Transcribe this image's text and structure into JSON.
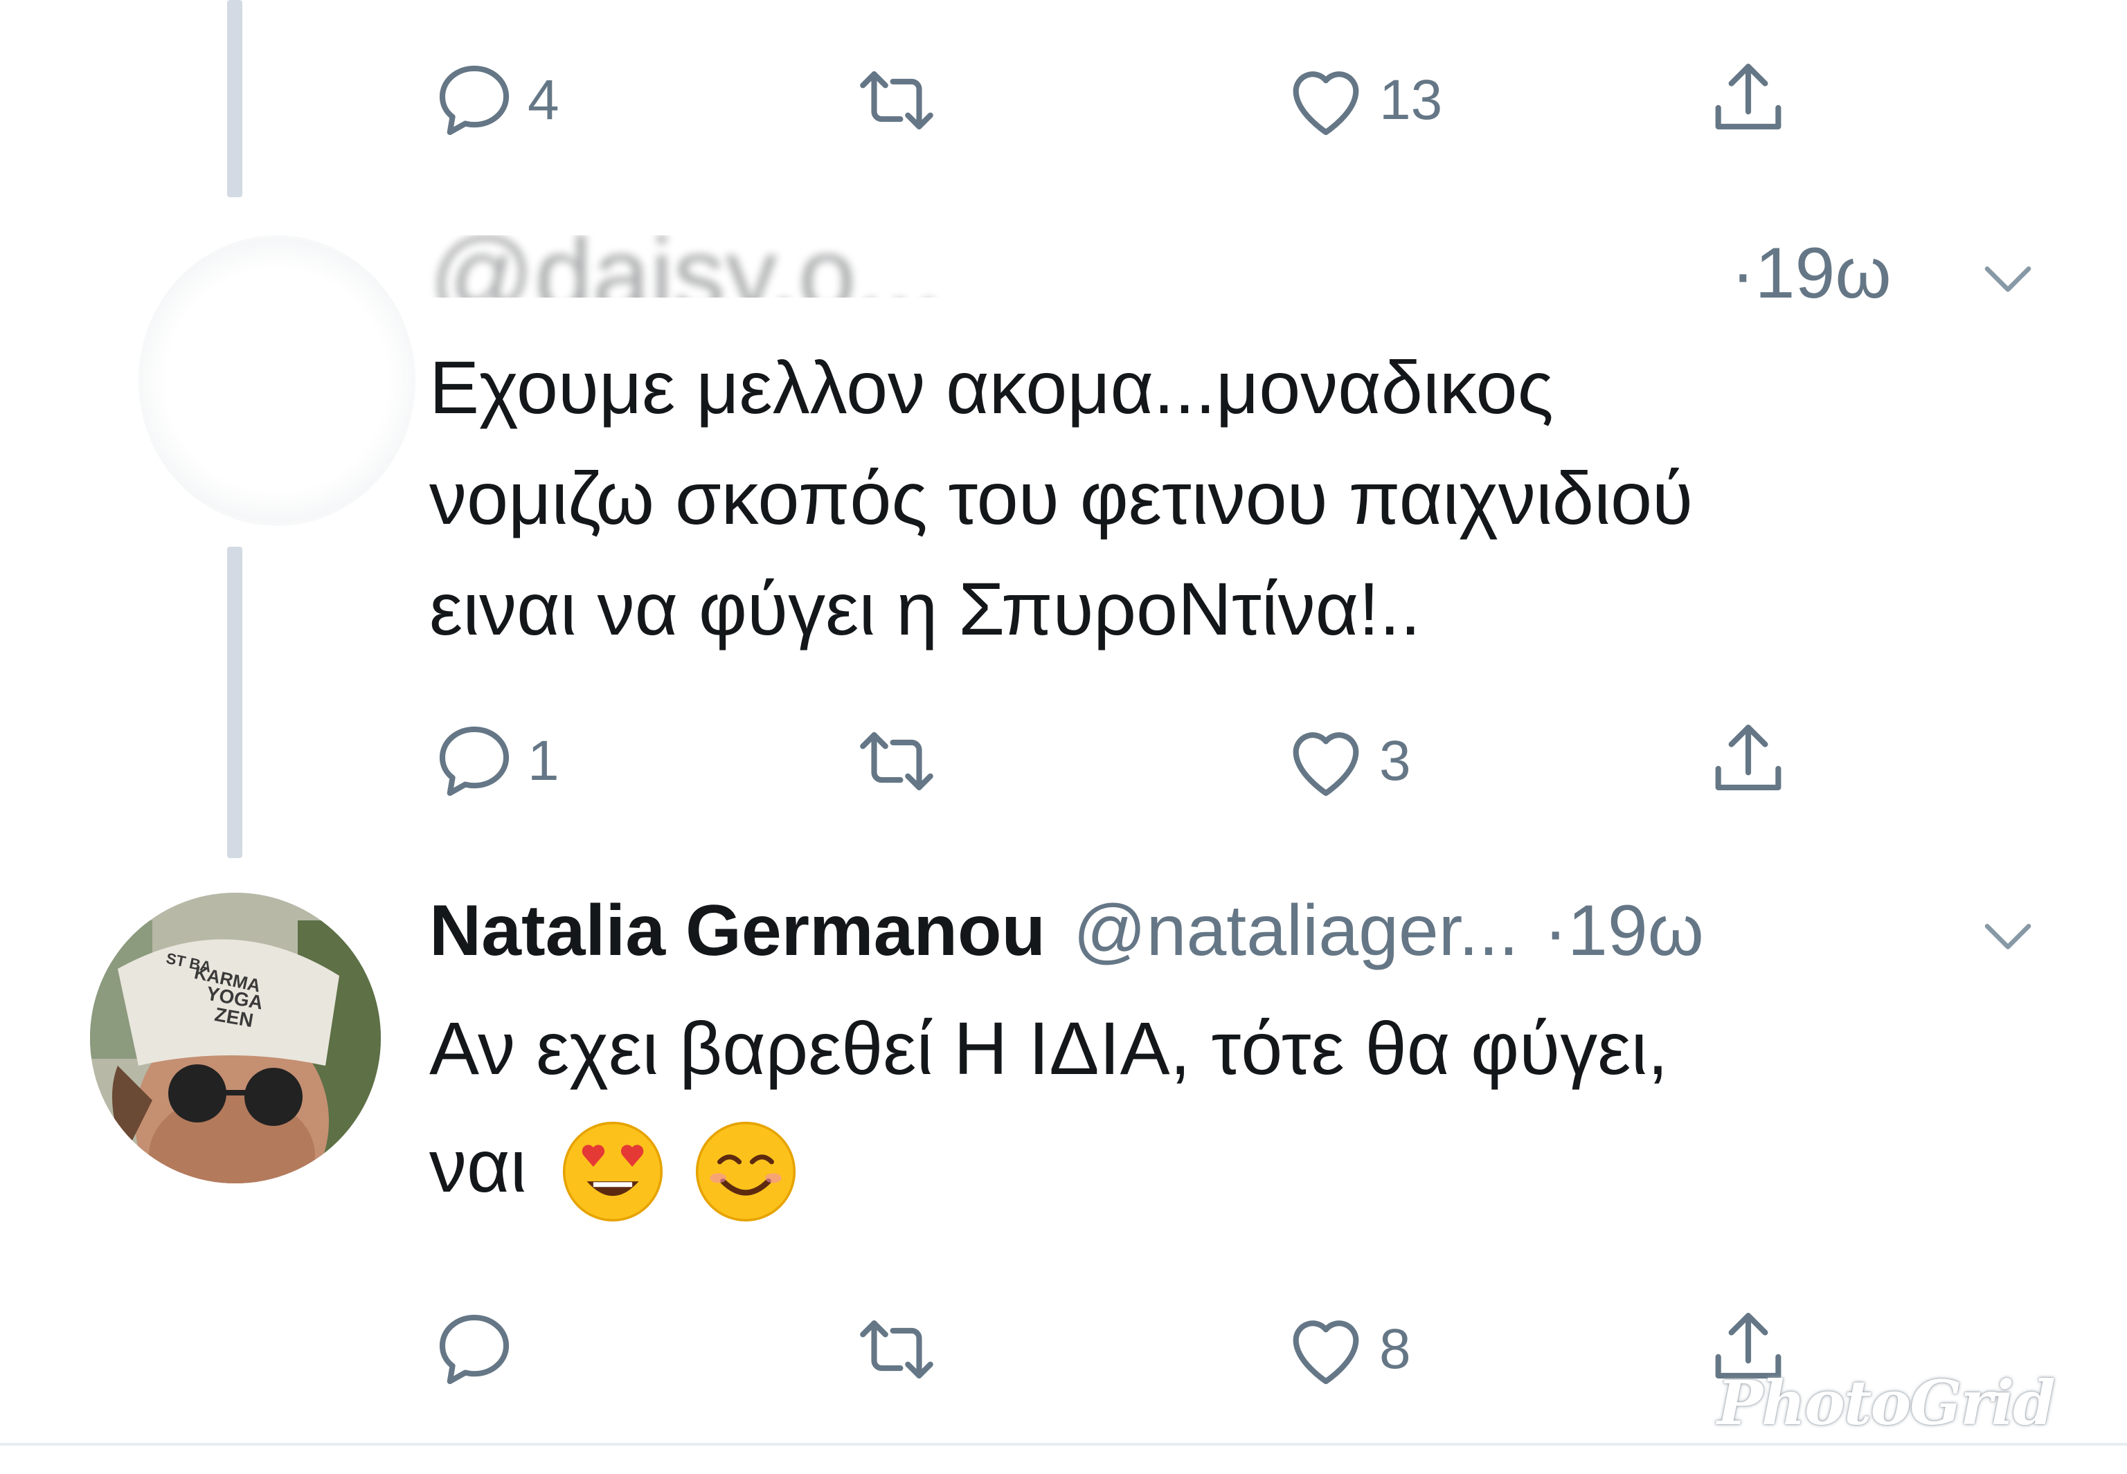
{
  "tweets": [
    {
      "actions": {
        "reply": "4",
        "retweet": "",
        "like": "13"
      }
    },
    {
      "name": "",
      "handle_obscured": "@daisy.o...",
      "time": "·19ω",
      "body_lines": [
        "Εχουμε μελλον ακομα...μοναδικος",
        "νομιζω σκοπός του φετινου παιχνιδιού",
        "ειναι να φύγει η ΣπυροΝτίνα!.."
      ],
      "actions": {
        "reply": "1",
        "retweet": "",
        "like": "3"
      }
    },
    {
      "name": "Natalia Germanou",
      "handle": "@nataliager...",
      "time": "·19ω",
      "body_lines": [
        "Αν εχει βαρεθεί Η ΙΔΙΑ, τότε θα φύγει,",
        "ναι"
      ],
      "emojis": [
        "heart-eyes-emoji",
        "smiling-emoji"
      ],
      "avatar_cap_text": [
        "ST BA",
        "KARMA",
        "YOGA",
        "ZEN"
      ],
      "actions": {
        "reply": "",
        "retweet": "",
        "like": "8"
      }
    }
  ],
  "watermark": "PhotoGrid",
  "colors": {
    "icon": "#657786",
    "text": "#14171a",
    "thread": "#d3dae3"
  }
}
